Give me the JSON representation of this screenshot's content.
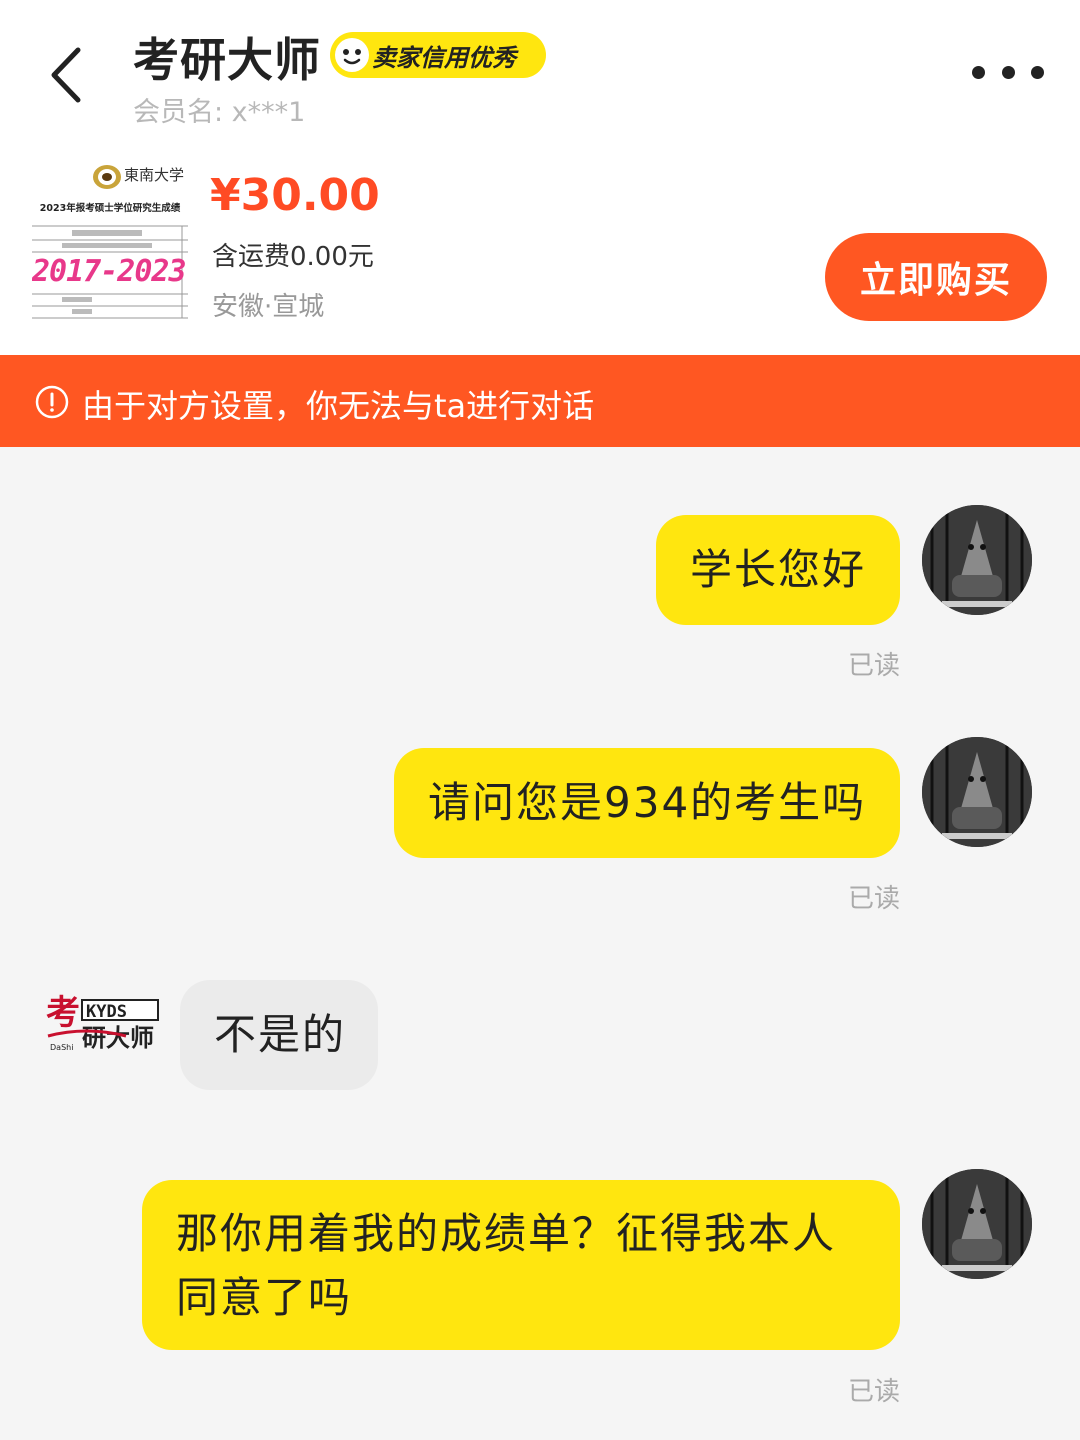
{
  "header": {
    "title": "考研大师",
    "badge": "卖家信用优秀",
    "member": "会员名: x***1"
  },
  "product": {
    "thumb_university": "東南大学",
    "thumb_caption": "2023年报考硕士学位研究生成绩",
    "thumb_years": "2017-2023",
    "price": "¥30.00",
    "shipping": "含运费0.00元",
    "location": "安徽·宣城",
    "buy_label": "立即购买"
  },
  "warning": {
    "text": "由于对方设置，你无法与ta进行对话"
  },
  "messages": [
    {
      "from": "me",
      "text": "学长您好",
      "status": "已读"
    },
    {
      "from": "me",
      "text": "请问您是934的考生吗",
      "status": "已读"
    },
    {
      "from": "seller",
      "text": "不是的"
    },
    {
      "from": "me",
      "line1": "那你用着我的成绩单？征得我本人",
      "line2": "同意了吗",
      "status": "已读"
    }
  ],
  "colors": {
    "accent_orange": "#ff5722",
    "price_red": "#ff4b24",
    "bubble_yellow": "#ffe60f",
    "bubble_gray": "#ebebeb"
  }
}
